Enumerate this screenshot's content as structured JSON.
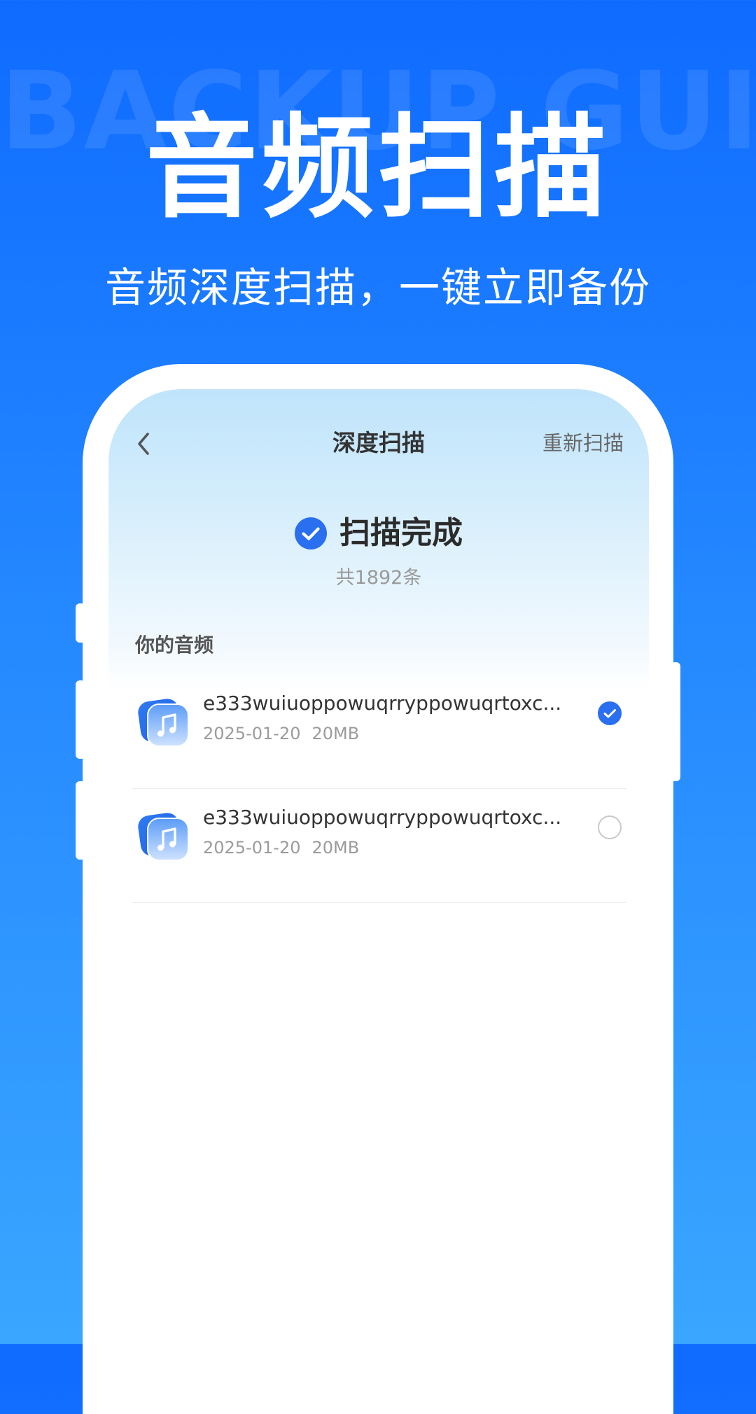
{
  "hero": {
    "watermark": "BACKUP GUIDE",
    "title": "音频扫描",
    "subtitle": "音频深度扫描，一键立即备份"
  },
  "nav": {
    "back_icon": "chevron-left-icon",
    "title": "深度扫描",
    "action_label": "重新扫描"
  },
  "scan": {
    "status_icon": "check-circle-icon",
    "status_text": "扫描完成",
    "count_text": "共1892条"
  },
  "list": {
    "section_label": "你的音频",
    "items": [
      {
        "icon": "music-file-icon",
        "name": "e333wuiuoppowuqrryppowuqrtoxc...",
        "date": "2025-01-20",
        "size": "20MB",
        "selected": true
      },
      {
        "icon": "music-file-icon",
        "name": "e333wuiuoppowuqrryppowuqrtoxc...",
        "date": "2025-01-20",
        "size": "20MB",
        "selected": false
      }
    ]
  },
  "colors": {
    "accent": "#2a6ff0",
    "background_top": "#0f6bff",
    "background_bottom": "#3aa6ff"
  }
}
